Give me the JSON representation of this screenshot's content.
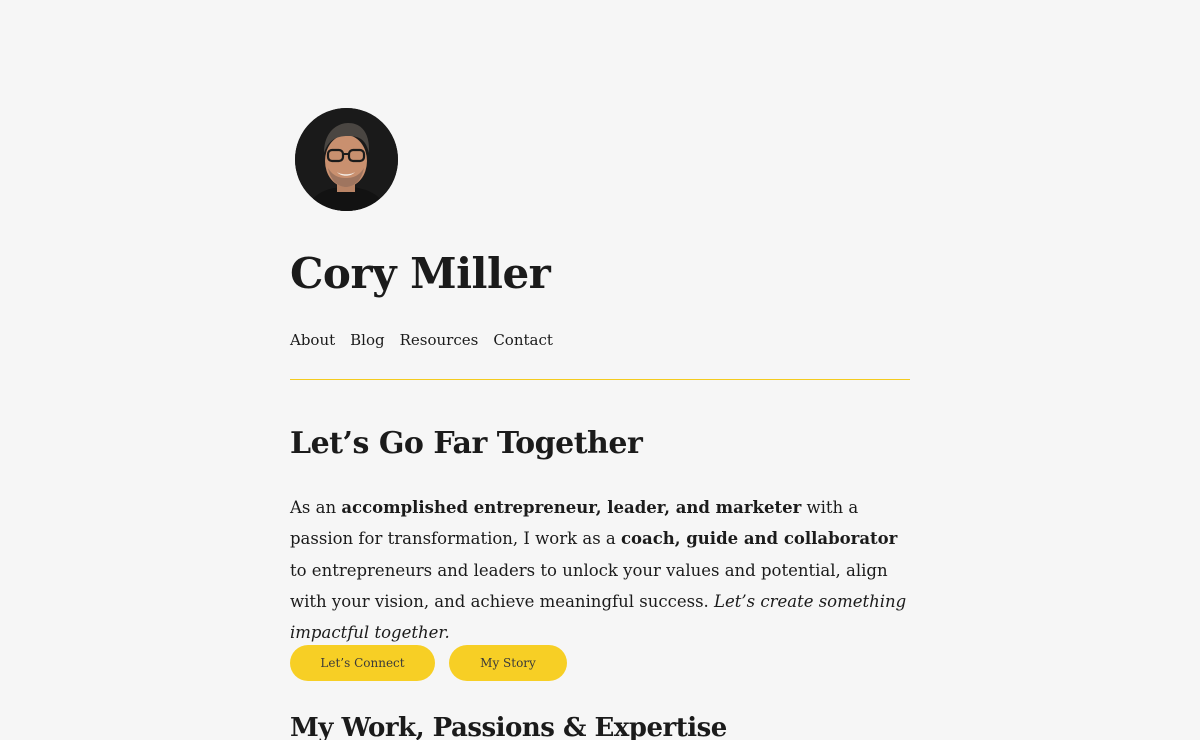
{
  "site": {
    "title": "Cory Miller",
    "avatar_alt": "Portrait of Cory Miller"
  },
  "nav": {
    "items": [
      "About",
      "Blog",
      "Resources",
      "Contact"
    ]
  },
  "colors": {
    "background": "#f6f6f6",
    "accent": "#f7cf25",
    "divider": "#f4cb1e",
    "text": "#1b1b1b"
  },
  "hero": {
    "heading": "Let’s Go Far Together",
    "intro": {
      "t1": "As an ",
      "b1": "accomplished entrepreneur, leader, and marketer",
      "t2": " with a passion for transformation, I work as a ",
      "b2": "coach, guide and collaborator",
      "t3": " to entrepreneurs and leaders to unlock your values and potential, align with your vision, and achieve meaningful success. ",
      "i1": "Let’s create something impactful together."
    },
    "buttons": {
      "connect": "Let’s Connect",
      "story": "My Story"
    }
  },
  "section": {
    "heading": "My Work, Passions & Expertise"
  }
}
